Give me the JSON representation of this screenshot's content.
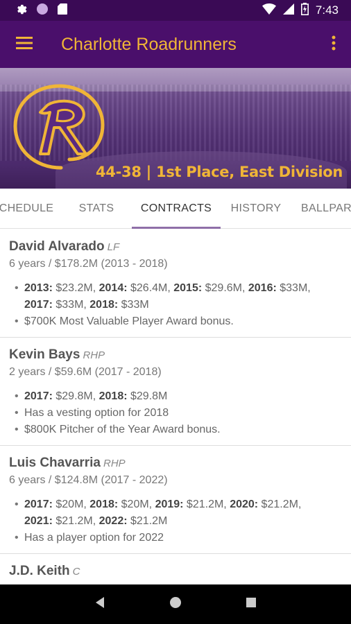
{
  "status_bar": {
    "time": "7:43"
  },
  "app_bar": {
    "title": "Charlotte Roadrunners"
  },
  "hero": {
    "record": "44-38 | 1st Place, East Division"
  },
  "tabs": [
    "CHEDULE",
    "STATS",
    "CONTRACTS",
    "HISTORY",
    "BALLPAR"
  ],
  "players": [
    {
      "name": "David Alvarado",
      "position": "LF",
      "summary": "6 years / $178.2M (2013 - 2018)",
      "salary_line1": [
        {
          "year": "2013:",
          "amt": " $23.2M, "
        },
        {
          "year": "2014:",
          "amt": " $26.4M, "
        },
        {
          "year": "2015:",
          "amt": " $29.6M, "
        },
        {
          "year": "2016:",
          "amt": " $33M,"
        }
      ],
      "salary_line2": [
        {
          "year": "2017:",
          "amt": " $33M, "
        },
        {
          "year": "2018:",
          "amt": " $33M"
        }
      ],
      "notes": [
        "$700K Most Valuable Player Award bonus."
      ]
    },
    {
      "name": "Kevin Bays",
      "position": "RHP",
      "summary": "2 years / $59.6M (2017 - 2018)",
      "salary_line1": [
        {
          "year": "2017:",
          "amt": " $29.8M, "
        },
        {
          "year": "2018:",
          "amt": " $29.8M"
        }
      ],
      "salary_line2": [],
      "notes": [
        "Has a vesting option for 2018",
        "$800K Pitcher of the Year Award bonus."
      ]
    },
    {
      "name": "Luis Chavarria",
      "position": "RHP",
      "summary": "6 years / $124.8M (2017 - 2022)",
      "salary_line1": [
        {
          "year": "2017:",
          "amt": " $20M, "
        },
        {
          "year": "2018:",
          "amt": " $20M, "
        },
        {
          "year": "2019:",
          "amt": " $21.2M, "
        },
        {
          "year": "2020:",
          "amt": " $21.2M,"
        }
      ],
      "salary_line2": [
        {
          "year": "2021:",
          "amt": " $21.2M, "
        },
        {
          "year": "2022:",
          "amt": " $21.2M"
        }
      ],
      "notes": [
        "Has a player option for 2022"
      ]
    },
    {
      "name": "J.D. Keith",
      "position": "C",
      "summary": "",
      "salary_line1": [],
      "salary_line2": [],
      "notes": []
    }
  ],
  "colors": {
    "status_bar": "#3a0a55",
    "app_bar": "#4a0f6b",
    "accent_gold": "#f0b537",
    "tab_indicator": "#8f6fa8"
  },
  "icons": [
    "settings-icon",
    "notification-circle-icon",
    "sd-card-icon",
    "wifi-icon",
    "signal-icon",
    "battery-icon",
    "menu-icon",
    "overflow-menu-icon",
    "back-icon",
    "home-icon",
    "recents-icon"
  ]
}
